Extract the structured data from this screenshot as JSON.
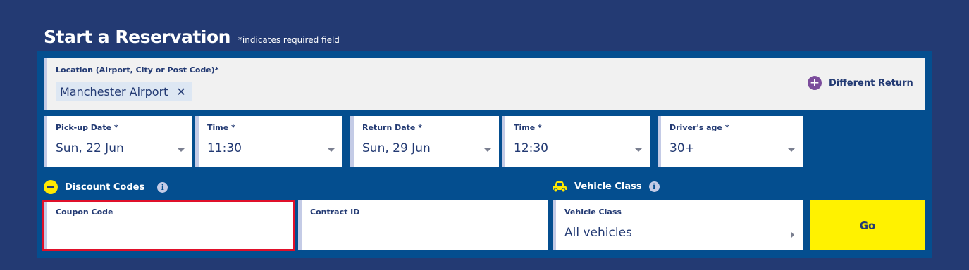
{
  "header": {
    "title": "Start a Reservation",
    "required_note": "*indicates required field"
  },
  "location": {
    "label": "Location (Airport, City or Post Code)*",
    "value": "Manchester Airport",
    "clear_glyph": "✕",
    "different_return_label": "Different Return",
    "different_return_icon": "plus-circle-icon"
  },
  "fields": {
    "pickup_date": {
      "label": "Pick-up Date *",
      "value": "Sun, 22 Jun"
    },
    "pickup_time": {
      "label": "Time *",
      "value": "11:30"
    },
    "return_date": {
      "label": "Return Date *",
      "value": "Sun, 29 Jun"
    },
    "return_time": {
      "label": "Time *",
      "value": "12:30"
    },
    "drivers_age": {
      "label": "Driver's age *",
      "value": "30+"
    }
  },
  "discount": {
    "section_label": "Discount Codes",
    "coupon_label": "Coupon Code",
    "coupon_value": "",
    "contract_label": "Contract ID",
    "contract_value": ""
  },
  "vehicle": {
    "section_label": "Vehicle Class",
    "field_label": "Vehicle Class",
    "value": "All vehicles"
  },
  "go_button": {
    "label": "Go"
  },
  "info_glyph": "i",
  "colors": {
    "background": "#233a73",
    "panel": "#044e8f",
    "accent_yellow": "#fff200",
    "accent_purple": "#7c4d9c",
    "highlight_red": "#e0102a",
    "text_navy": "#233a73"
  }
}
